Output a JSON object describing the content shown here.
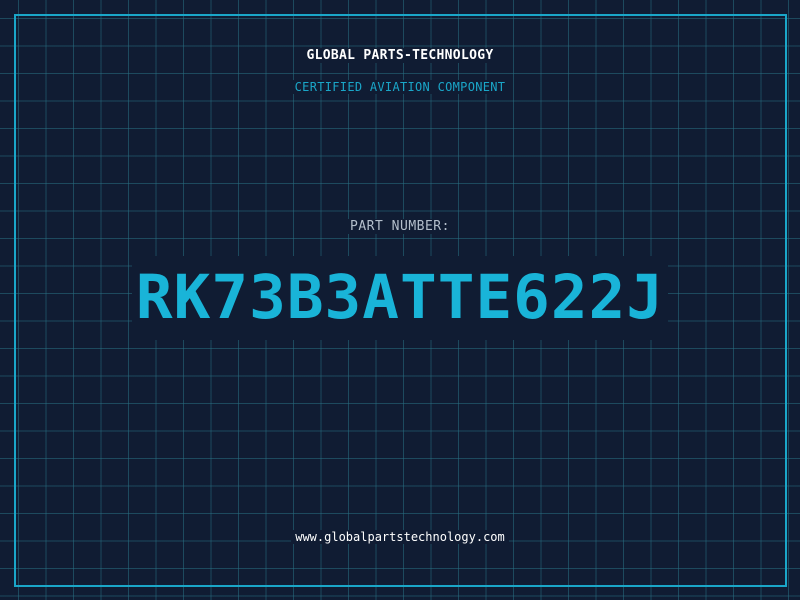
{
  "company_name": "GLOBAL PARTS-TECHNOLOGY",
  "certification": "CERTIFIED AVIATION COMPONENT",
  "part_number_label": "PART NUMBER:",
  "part_number": "RK73B3ATTE622J",
  "website": "www.globalpartstechnology.com",
  "colors": {
    "background": "#101c33",
    "accent": "#1aa6c8",
    "grid": "#286e82",
    "text": "#ffffff"
  }
}
